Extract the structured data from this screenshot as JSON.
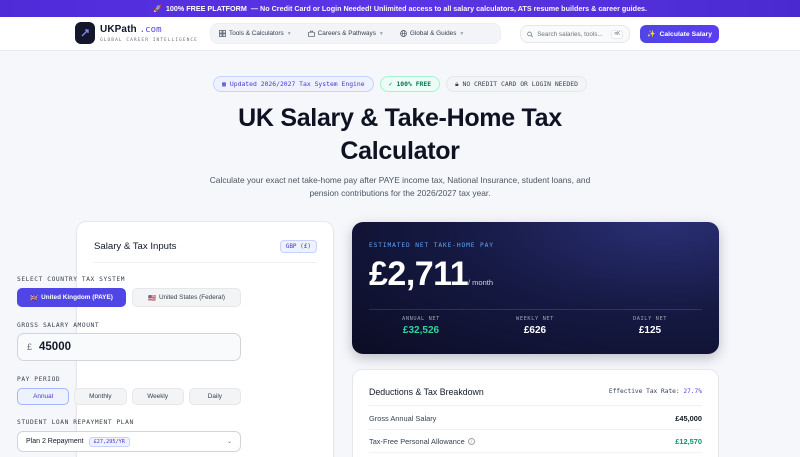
{
  "promo": {
    "highlight": "100% FREE PLATFORM",
    "text": "— No Credit Card or Login Needed! Unlimited access to all salary calculators, ATS resume builders & career guides."
  },
  "nav": {
    "brand_name": "UKPath",
    "brand_domain": ".com",
    "brand_tagline": "GLOBAL CAREER INTELLIGENCE",
    "items": [
      {
        "label": "Tools & Calculators",
        "icon": "grid-icon"
      },
      {
        "label": "Careers & Pathways",
        "icon": "briefcase-icon"
      },
      {
        "label": "Global & Guides",
        "icon": "globe-icon"
      }
    ],
    "search_placeholder": "Search salaries, tools...",
    "search_shortcut": "⌘K",
    "cta_label": "Calculate Salary"
  },
  "badges": {
    "updated": "Updated 2026/2027 Tax System Engine",
    "free": "100% FREE",
    "no_card": "NO CREDIT CARD OR LOGIN NEEDED"
  },
  "hero": {
    "title_line1": "UK Salary & Take-Home Tax",
    "title_line2": "Calculator",
    "lede": "Calculate your exact net take-home pay after PAYE income tax, National Insurance, student loans, and pension contributions for the 2026/2027 tax year."
  },
  "inputs": {
    "title": "Salary & Tax Inputs",
    "currency": "GBP (£)",
    "country_label": "SELECT COUNTRY TAX SYSTEM",
    "country_options": [
      {
        "label": "United Kingdom (PAYE)",
        "flag": "🇬🇧",
        "active": true
      },
      {
        "label": "United States (Federal)",
        "flag": "🇺🇸",
        "active": false
      }
    ],
    "salary_label": "GROSS SALARY AMOUNT",
    "salary_symbol": "£",
    "salary_value": "45000",
    "period_label": "PAY PERIOD",
    "periods": [
      {
        "label": "Annual",
        "active": true
      },
      {
        "label": "Monthly",
        "active": false
      },
      {
        "label": "Weekly",
        "active": false
      },
      {
        "label": "Daily",
        "active": false
      }
    ],
    "loan_label": "STUDENT LOAN REPAYMENT PLAN",
    "loan_value": "Plan 2 Repayment",
    "loan_threshold": "£27,295/YR"
  },
  "result": {
    "label": "ESTIMATED NET TAKE-HOME PAY",
    "monthly": "£2,711",
    "per": "/ month",
    "stats": [
      {
        "label": "ANNUAL NET",
        "value": "£32,526",
        "accent": true
      },
      {
        "label": "WEEKLY NET",
        "value": "£626",
        "accent": false
      },
      {
        "label": "DAILY NET",
        "value": "£125",
        "accent": false
      }
    ]
  },
  "breakdown": {
    "title": "Deductions & Tax Breakdown",
    "rate_label": "Effective Tax Rate:",
    "rate_value": "27.7%",
    "rows": [
      {
        "name": "Gross Annual Salary",
        "amount": "£45,000",
        "green": false,
        "info": false
      },
      {
        "name": "Tax-Free Personal Allowance",
        "amount": "£12,570",
        "green": true,
        "info": true
      }
    ]
  },
  "colors": {
    "accent": "#4f46e5",
    "promo_bg": "#5231dc",
    "hero_card": "#141838",
    "positive": "#059669"
  }
}
